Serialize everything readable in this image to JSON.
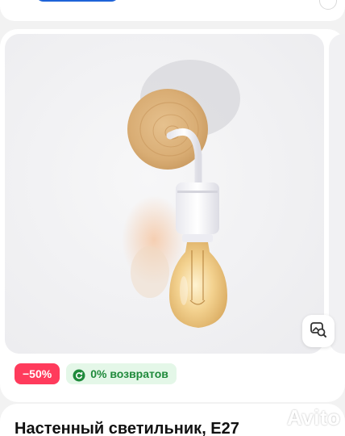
{
  "badges": {
    "discount": "−50%",
    "returns": "0% возвратов"
  },
  "product": {
    "title": "Настенный светильник, E27"
  },
  "icons": {
    "search_photo": "image-search-icon",
    "returns": "return-arrow-icon"
  },
  "watermark": {
    "text": "Avito"
  },
  "colors": {
    "discount_badge": "#ff3b5c",
    "returns_badge_bg": "#e4f7e8",
    "returns_badge_text": "#1f8a3b",
    "accent_button": "#1e63d8"
  }
}
